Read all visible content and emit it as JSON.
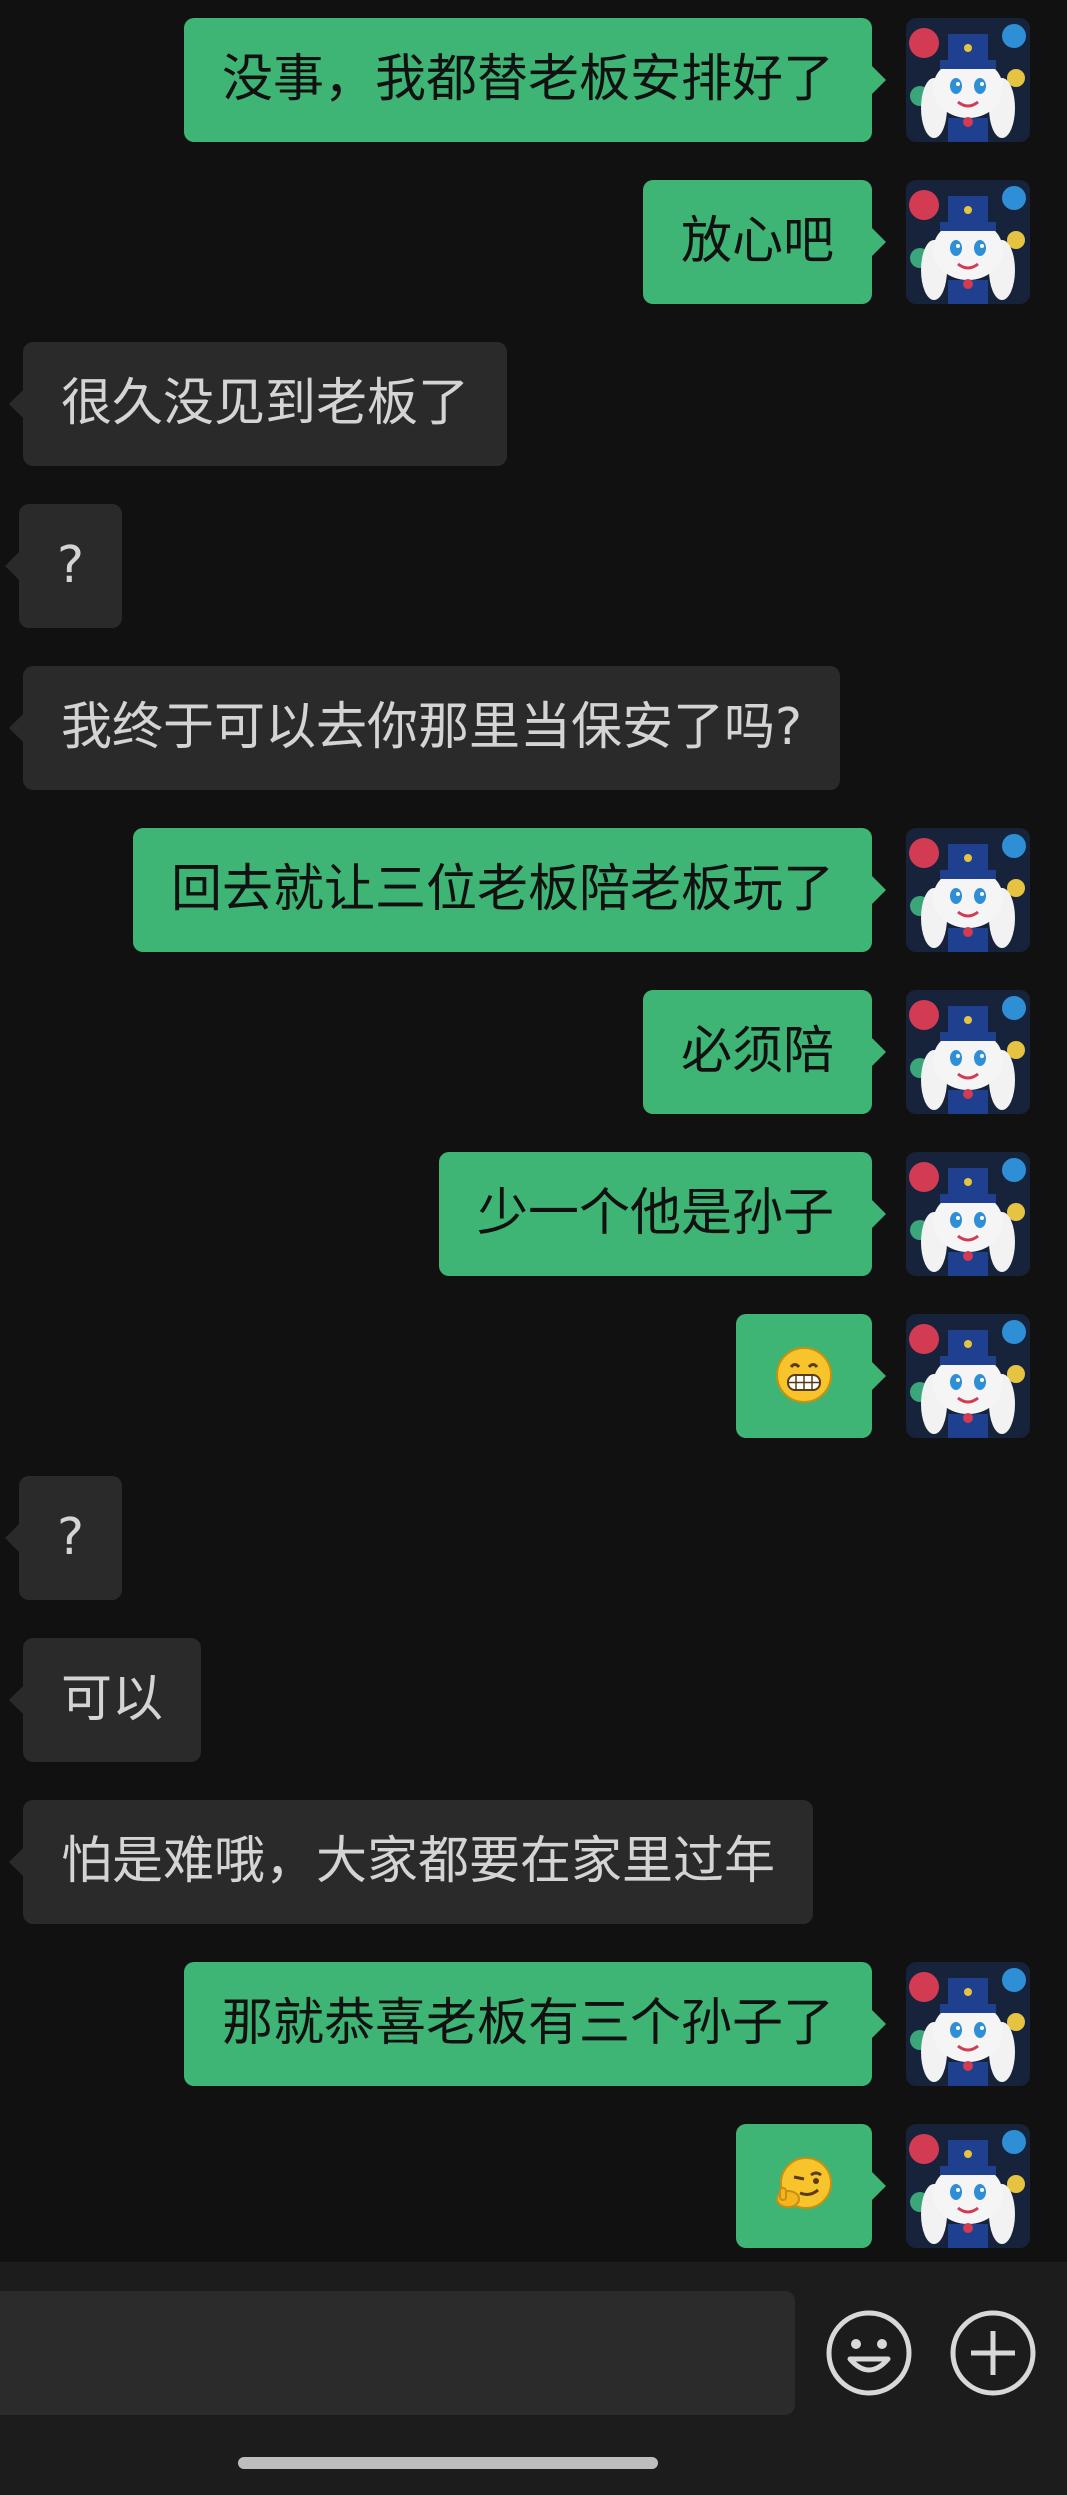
{
  "messages": [
    {
      "side": "me",
      "text": "没事，我都替老板安排好了"
    },
    {
      "side": "me",
      "text": "放心吧"
    },
    {
      "side": "other",
      "text": "很久没见到老板了"
    },
    {
      "side": "other",
      "text": "?"
    },
    {
      "side": "other",
      "text": "我终于可以去你那里当保安了吗?"
    },
    {
      "side": "me",
      "text": "回去就让三位老板陪老板玩了"
    },
    {
      "side": "me",
      "text": "必须陪"
    },
    {
      "side": "me",
      "text": "少一个他是孙子"
    },
    {
      "side": "me",
      "emoji": "grin-emoji"
    },
    {
      "side": "other",
      "text": "?"
    },
    {
      "side": "other",
      "text": "可以"
    },
    {
      "side": "other",
      "text": "怕是难哦，大家都要在家里过年"
    },
    {
      "side": "me",
      "text": "那就恭喜老板有三个孙子了"
    },
    {
      "side": "me",
      "emoji": "smirk-emoji"
    }
  ],
  "input": {
    "value": "",
    "placeholder": ""
  },
  "icons": {
    "avatar": "rabbit-avatar-icon",
    "emoji_button": "smiley-icon",
    "more_button": "plus-circle-icon"
  },
  "colors": {
    "background": "#111111",
    "my_bubble": "#3eb574",
    "other_bubble": "#2a2a2a",
    "bottom_bar": "#1c1c1c"
  }
}
